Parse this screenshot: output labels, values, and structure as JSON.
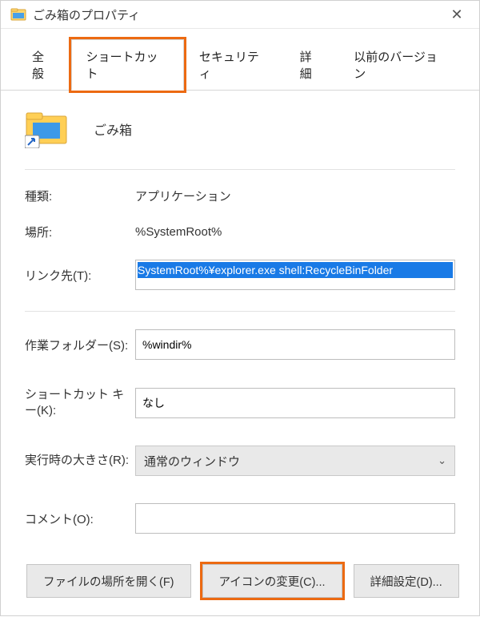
{
  "window": {
    "title": "ごみ箱のプロパティ"
  },
  "tabs": {
    "general": "全般",
    "shortcut": "ショートカット",
    "security": "セキュリティ",
    "details": "詳細",
    "previous": "以前のバージョン"
  },
  "header": {
    "name": "ごみ箱"
  },
  "fields": {
    "type_label": "種類:",
    "type_value": "アプリケーション",
    "location_label": "場所:",
    "location_value": "%SystemRoot%",
    "target_label": "リンク先(T):",
    "target_value": "SystemRoot%¥explorer.exe shell:RecycleBinFolder",
    "startin_label": "作業フォルダー(S):",
    "startin_value": "%windir%",
    "shortcutkey_label": "ショートカット キー(K):",
    "shortcutkey_value": "なし",
    "run_label": "実行時の大きさ(R):",
    "run_value": "通常のウィンドウ",
    "comment_label": "コメント(O):",
    "comment_value": ""
  },
  "buttons": {
    "open_location": "ファイルの場所を開く(F)",
    "change_icon": "アイコンの変更(C)...",
    "advanced": "詳細設定(D)..."
  }
}
